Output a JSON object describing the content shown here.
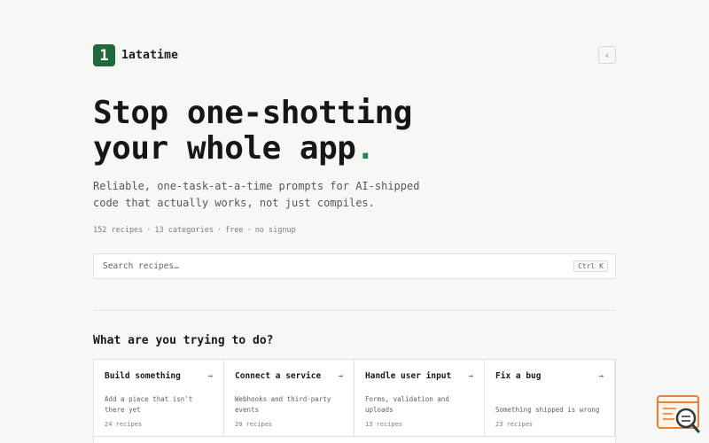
{
  "brand": {
    "logo_char": "1",
    "name": "1atatime"
  },
  "header": {
    "collapse_icon": "chevron-left-icon",
    "collapse_glyph": "‹"
  },
  "hero": {
    "title_line1": "Stop one-shotting",
    "title_line2": "your whole app",
    "title_dot": ".",
    "subtitle": "Reliable, one-task-at-a-time prompts for AI-shipped code that actually works, not just compiles."
  },
  "meta": {
    "recipes": "152 recipes",
    "categories": "13 categories",
    "free": "free",
    "signup": "no signup",
    "separator": "·"
  },
  "search": {
    "placeholder": "Search recipes…",
    "value": "",
    "shortcut": "Ctrl K"
  },
  "section": {
    "title": "What are you trying to do?"
  },
  "cards": [
    {
      "title": "Build something",
      "arrow": "→",
      "description": "Add a piece that isn't there yet",
      "count": "24 recipes"
    },
    {
      "title": "Connect a service",
      "arrow": "→",
      "description": "Webhooks and third-party events",
      "count": "20 recipes"
    },
    {
      "title": "Handle user input",
      "arrow": "→",
      "description": "Forms, validation and uploads",
      "count": "13 recipes"
    },
    {
      "title": "Fix a bug",
      "arrow": "→",
      "description": "Something shipped is wrong",
      "count": "23 recipes"
    }
  ],
  "colors": {
    "accent": "#1f6b3b",
    "dot": "#1f8a4a",
    "widget": "#e8823a"
  }
}
